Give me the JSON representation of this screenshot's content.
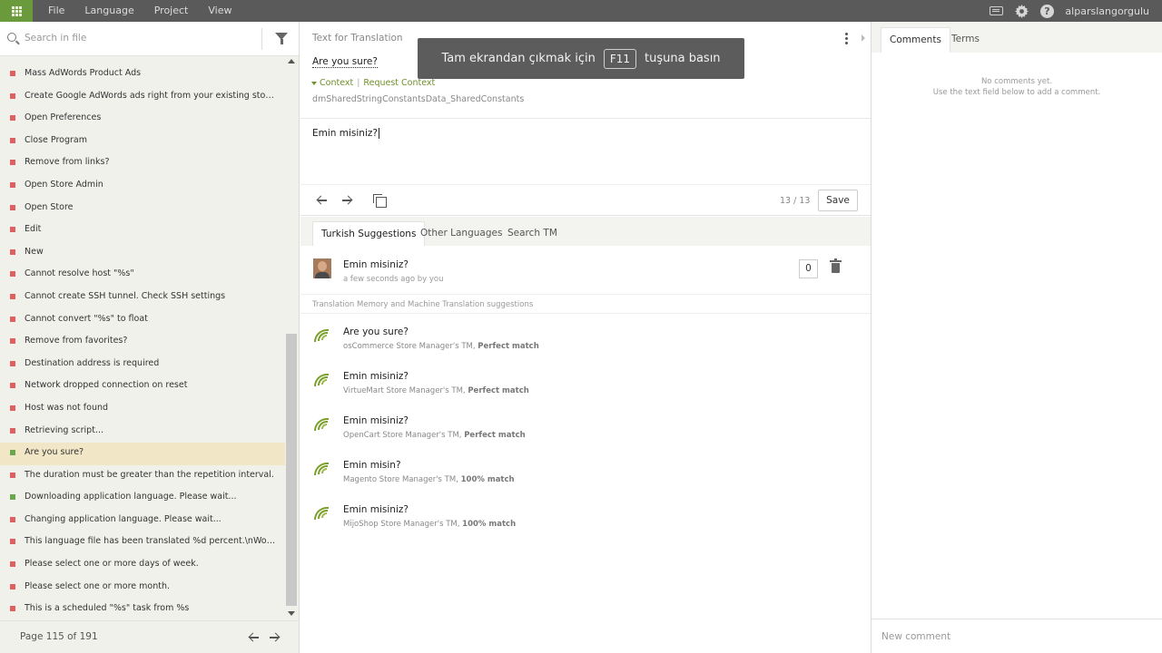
{
  "menu": {
    "items": [
      "File",
      "Language",
      "Project",
      "View"
    ],
    "username": "alparslangorgulu"
  },
  "left": {
    "search_placeholder": "Search in file",
    "items": [
      {
        "label": "Mass AdWords Product Ads",
        "status": "untranslated"
      },
      {
        "label": "Create Google AdWords ads right from your existing store products",
        "status": "untranslated"
      },
      {
        "label": "Open Preferences",
        "status": "untranslated"
      },
      {
        "label": "Close Program",
        "status": "untranslated"
      },
      {
        "label": "Remove from links?",
        "status": "untranslated"
      },
      {
        "label": "Open Store Admin",
        "status": "untranslated"
      },
      {
        "label": "Open Store",
        "status": "untranslated"
      },
      {
        "label": "Edit",
        "status": "untranslated"
      },
      {
        "label": "New",
        "status": "untranslated"
      },
      {
        "label": "Cannot resolve host \"%s\"",
        "status": "untranslated"
      },
      {
        "label": "Cannot create SSH tunnel. Check SSH settings",
        "status": "untranslated"
      },
      {
        "label": "Cannot convert \"%s\" to float",
        "status": "untranslated"
      },
      {
        "label": "Remove from favorites?",
        "status": "untranslated"
      },
      {
        "label": "Destination address is required",
        "status": "untranslated"
      },
      {
        "label": "Network dropped connection on reset",
        "status": "untranslated"
      },
      {
        "label": "Host was not found",
        "status": "untranslated"
      },
      {
        "label": "Retrieving script...",
        "status": "untranslated"
      },
      {
        "label": "Are you sure?",
        "status": "translated",
        "selected": true
      },
      {
        "label": "The duration must be greater than the repetition interval.",
        "status": "untranslated"
      },
      {
        "label": "Downloading application language. Please wait...",
        "status": "translated"
      },
      {
        "label": "Changing application language. Please wait...",
        "status": "untranslated"
      },
      {
        "label": "This language file has been translated %d percent.\\nWords or phrases...",
        "status": "untranslated"
      },
      {
        "label": "Please select one or more days of week.",
        "status": "untranslated"
      },
      {
        "label": "Please select one or more month.",
        "status": "untranslated"
      },
      {
        "label": "This is a scheduled \"%s\" task from %s",
        "status": "untranslated"
      }
    ],
    "pager": "Page 115 of 191"
  },
  "middle": {
    "source_label": "Text for Translation",
    "source_text": "Are you sure?",
    "context_label": "Context",
    "request_context": "Request Context",
    "key": "dmSharedStringConstantsData_SharedConstants",
    "translation_value": "Emin misiniz?",
    "counter": "13 / 13",
    "save_label": "Save",
    "tabs": [
      "Turkish Suggestions",
      "Other Languages",
      "Search TM"
    ],
    "own_suggestion": {
      "text": "Emin misiniz?",
      "meta": "a few seconds ago by you",
      "votes": "0"
    },
    "tm_header": "Translation Memory and Machine Translation suggestions",
    "suggestions": [
      {
        "text": "Are you sure?",
        "source": "osCommerce Store Manager's TM, ",
        "match": "Perfect match"
      },
      {
        "text": "Emin misiniz?",
        "source": "VirtueMart Store Manager's TM, ",
        "match": "Perfect match"
      },
      {
        "text": "Emin misiniz?",
        "source": "OpenCart Store Manager's TM, ",
        "match": "Perfect match"
      },
      {
        "text": "Emin misin?",
        "source": "Magento Store Manager's TM, ",
        "match": "100% match"
      },
      {
        "text": "Emin misiniz?",
        "source": "MijoShop Store Manager's TM, ",
        "match": "100% match"
      }
    ]
  },
  "right": {
    "tabs": [
      "Comments",
      "Terms"
    ],
    "empty_line1": "No comments yet.",
    "empty_line2": "Use the text field below to add a comment.",
    "new_comment_placeholder": "New comment"
  },
  "overlay": {
    "before": "Tam ekrandan çıkmak için",
    "key": "F11",
    "after": "tuşuna basın"
  },
  "colors": {
    "accent_green": "#6b9a3c",
    "topbar": "#5a5a5a",
    "untranslated_marker": "#e06060",
    "translated_marker": "#6aa84f",
    "selected_row": "#f1e7c7"
  }
}
